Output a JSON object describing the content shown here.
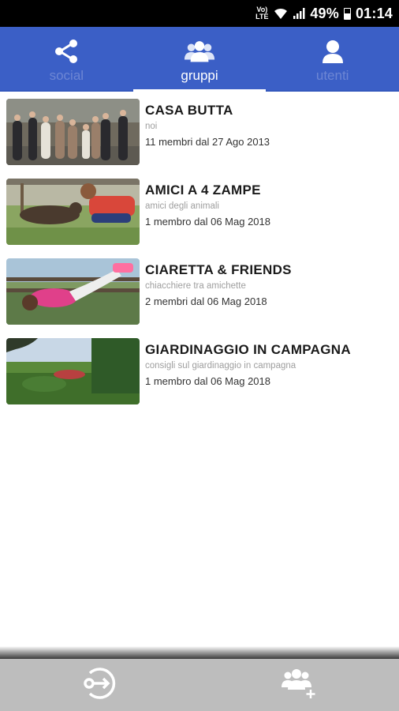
{
  "status_bar": {
    "volte_line1": "Vo)",
    "volte_line2": "LTE",
    "battery": "49%",
    "time": "01:14"
  },
  "tabs": [
    {
      "label": "social",
      "icon": "share-icon",
      "active": false
    },
    {
      "label": "gruppi",
      "icon": "group-icon",
      "active": true
    },
    {
      "label": "utenti",
      "icon": "user-icon",
      "active": false
    }
  ],
  "groups": [
    {
      "name": "CASA BUTTA",
      "description": "noi",
      "meta": "11 membri dal 27 Ago 2013",
      "image": "family-photo"
    },
    {
      "name": "AMICI A 4 ZAMPE",
      "description": "amici degli animali",
      "meta": "1 membro dal 06 Mag 2018",
      "image": "child-with-dog-photo"
    },
    {
      "name": "CIARETTA & FRIENDS",
      "description": "chiacchiere tra amichette",
      "meta": "2 membri dal 06 Mag 2018",
      "image": "girls-on-bench-photo"
    },
    {
      "name": "GIARDINAGGIO IN CAMPAGNA",
      "description": "consigli sul giardinaggio in campagna",
      "meta": "1 membro dal 06 Mag 2018",
      "image": "garden-landscape-photo"
    }
  ],
  "bottom_bar": {
    "left_icon": "exit-group-icon",
    "right_icon": "add-group-icon"
  },
  "colors": {
    "header_blue": "#3b5fc6",
    "bottom_bar_gray": "#bdbdbd",
    "inactive_tab_text": "#6d86d4"
  }
}
